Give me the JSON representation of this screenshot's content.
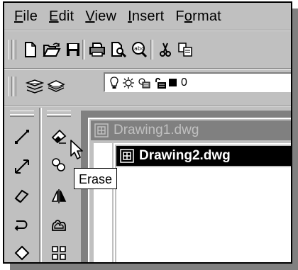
{
  "menubar": {
    "items": [
      {
        "label": "File",
        "mnemonic": "F",
        "rest": "ile"
      },
      {
        "label": "Edit",
        "mnemonic": "E",
        "rest": "dit"
      },
      {
        "label": "View",
        "mnemonic": "V",
        "rest": "iew"
      },
      {
        "label": "Insert",
        "mnemonic": "I",
        "rest": "nsert"
      },
      {
        "label": "Format",
        "mnemonic": "o",
        "rest_before": "F",
        "rest_after": "rmat"
      }
    ]
  },
  "standard_toolbar": {
    "buttons": [
      {
        "name": "new-icon"
      },
      {
        "name": "open-icon"
      },
      {
        "name": "save-icon"
      },
      {
        "name": "print-icon"
      },
      {
        "name": "print-preview-icon"
      },
      {
        "name": "spelling-icon"
      },
      {
        "name": "cut-icon"
      },
      {
        "name": "copy-icon"
      }
    ]
  },
  "layers_toolbar": {
    "layer_name": "0",
    "icons": [
      "layers-icon",
      "make-layer-current-icon",
      "lightbulb-icon",
      "sun-freeze-icon",
      "freeze-viewport-icon",
      "lock-icon",
      "color-swatch-icon"
    ],
    "color": "#000000"
  },
  "draw_toolbar": {
    "icons": [
      "line-icon",
      "construction-line-icon",
      "polyline-icon",
      "arc-icon",
      "polygon-icon"
    ]
  },
  "modify_toolbar": {
    "icons": [
      "erase-icon",
      "copy-object-icon",
      "mirror-icon",
      "offset-icon",
      "array-icon"
    ]
  },
  "windows": [
    {
      "title": "Drawing1.dwg",
      "active": false
    },
    {
      "title": "Drawing2.dwg",
      "active": true
    }
  ],
  "tooltip": {
    "text": "Erase"
  },
  "colors": {
    "face": "#c0c0c0",
    "shadow": "#808080",
    "highlight": "#ffffff",
    "active_title": "#000000",
    "inactive_title": "#808080"
  }
}
